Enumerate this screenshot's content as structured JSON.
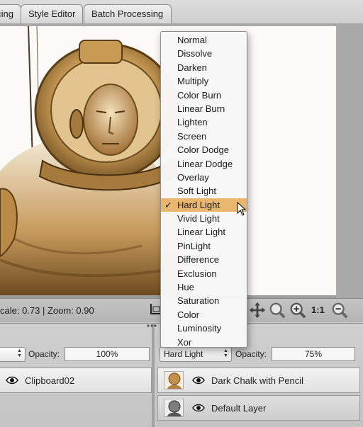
{
  "tabs": [
    {
      "label": "cing"
    },
    {
      "label": "Style Editor"
    },
    {
      "label": "Batch Processing"
    }
  ],
  "statusbar": {
    "text": "cale: 0.73  |  Zoom: 0.90",
    "zoom_actual_label": "1:1"
  },
  "left_pane": {
    "opacity_label": "Opacity:",
    "opacity_value": "100%",
    "layer_name": "Clipboard02"
  },
  "right_pane": {
    "blend_mode": "Hard Light",
    "opacity_label": "Opacity:",
    "opacity_value": "75%",
    "layers": [
      {
        "name": "Dark Chalk with Pencil"
      },
      {
        "name": "Default Layer"
      }
    ]
  },
  "blend_menu": {
    "items": [
      "Normal",
      "Dissolve",
      "Darken",
      "Multiply",
      "Color Burn",
      "Linear Burn",
      "Lighten",
      "Screen",
      "Color Dodge",
      "Linear Dodge",
      "Overlay",
      "Soft Light",
      "Hard Light",
      "Vivid Light",
      "Linear Light",
      "PinLight",
      "Difference",
      "Exclusion",
      "Hue",
      "Saturation",
      "Color",
      "Luminosity",
      "Xor"
    ],
    "selected": "Hard Light",
    "check_glyph": "✓"
  },
  "colors": {
    "menu_highlight": "#e9b66e",
    "sepia_dark": "#6b4a1e",
    "sepia_mid": "#b98a45"
  }
}
